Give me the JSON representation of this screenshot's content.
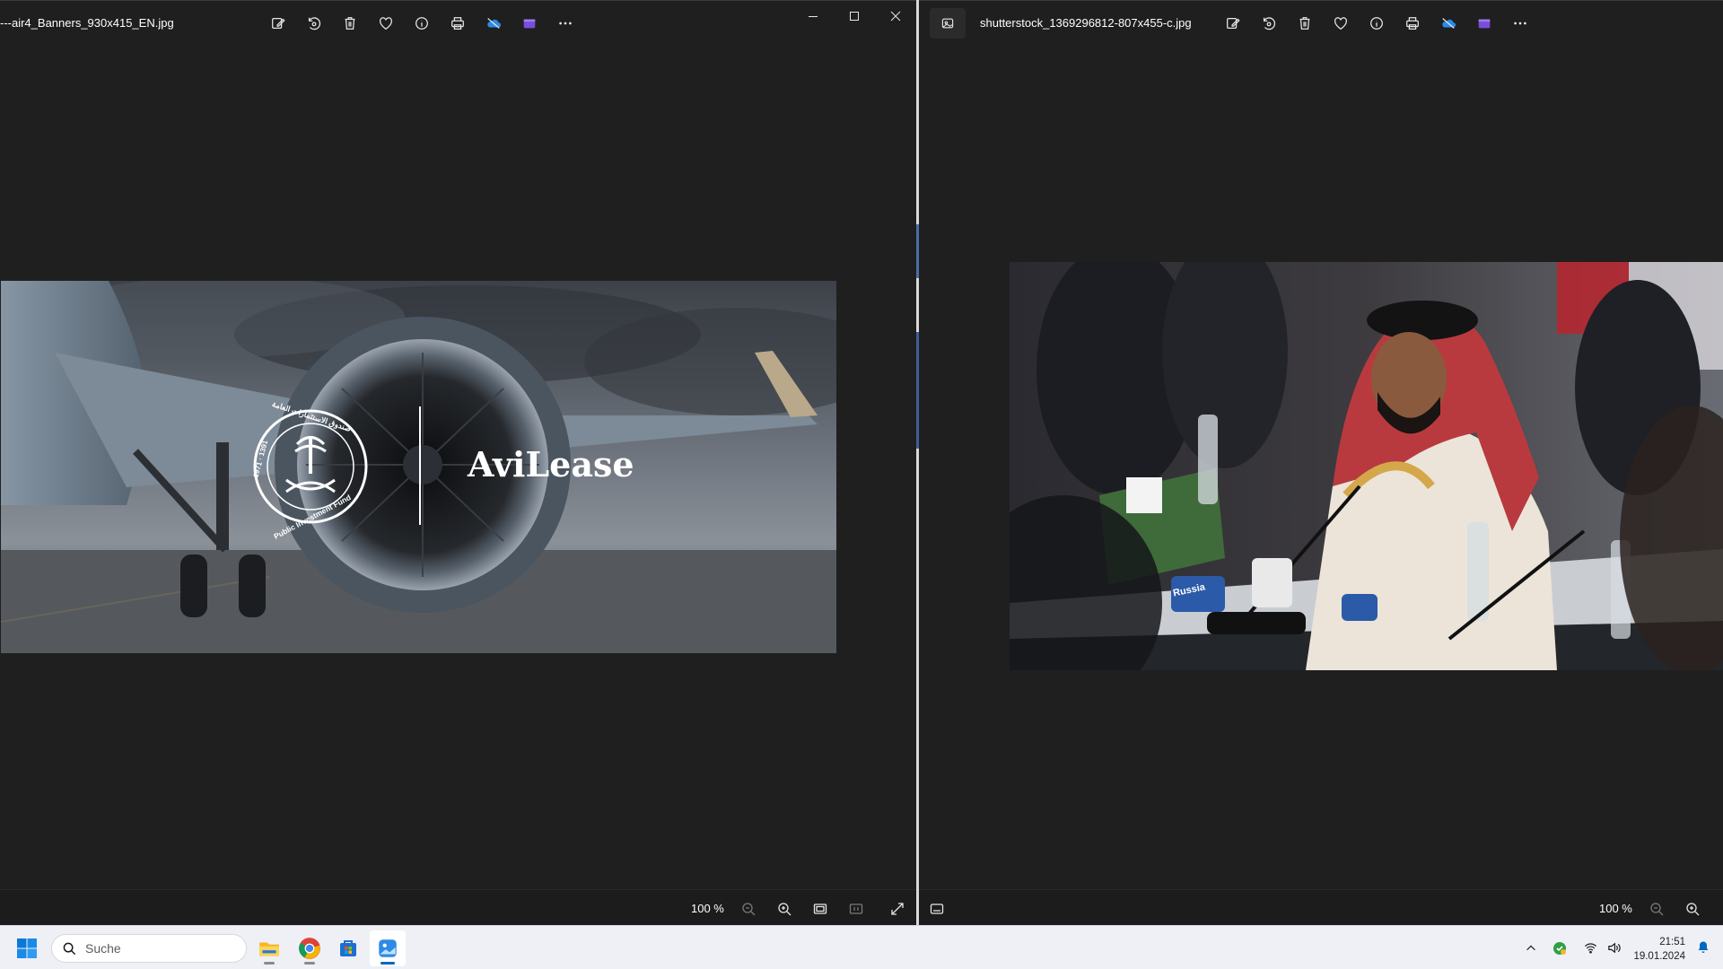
{
  "left_window": {
    "filename": "---air4_Banners_930x415_EN.jpg",
    "toolbar": [
      "edit-icon",
      "rotate-icon",
      "delete-icon",
      "favorite-icon",
      "info-icon",
      "print-icon",
      "onedrive-icon",
      "clipchamp-icon",
      "more-icon"
    ],
    "caption": [
      "minimize-icon",
      "maximize-icon",
      "close-icon"
    ],
    "zoom": "100 %",
    "banner": {
      "brand": "AviLease",
      "seal_text": "Public Investment Fund",
      "seal_arabic": "صندوق الاستثمارات العامة",
      "seal_years": "1971 · 1391"
    }
  },
  "right_window": {
    "filename": "shutterstock_1369296812-807x455-c.jpg",
    "toolbar": [
      "edit-icon",
      "rotate-icon",
      "delete-icon",
      "favorite-icon",
      "info-icon",
      "print-icon",
      "onedrive-icon",
      "clipchamp-icon",
      "more-icon"
    ],
    "zoom": "100 %",
    "photo": {
      "sign": "Russia"
    }
  },
  "taskbar": {
    "search_placeholder": "Suche",
    "apps": [
      "file-explorer-icon",
      "chrome-icon",
      "store-icon",
      "photos-icon"
    ],
    "tray": [
      "chevron-up-icon",
      "security-icon",
      "wifi-icon",
      "volume-icon"
    ],
    "time": "21:51",
    "date": "19.01.2024"
  }
}
